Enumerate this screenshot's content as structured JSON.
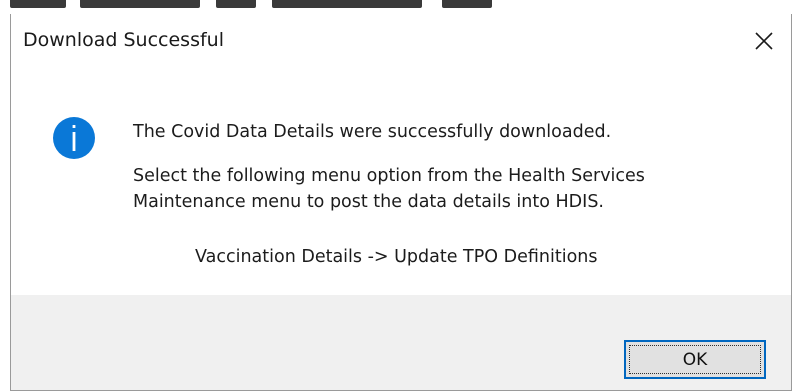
{
  "dialog": {
    "title": "Download Successful",
    "close_icon": "close-icon",
    "icon": "info-icon",
    "accent_color": "#0a78d7",
    "messages": {
      "line1": "The Covid Data Details were successfully downloaded.",
      "line2": "Select the following menu option from the Health Services",
      "line3": "Maintenance menu to post the data details into HDIS.",
      "menu_path": "Vaccination Details -> Update TPO Definitions"
    },
    "ok_label": "OK"
  }
}
